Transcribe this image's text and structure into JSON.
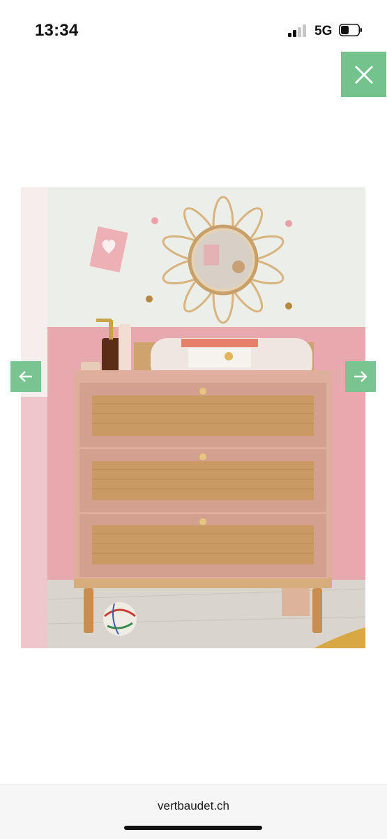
{
  "status_bar": {
    "time": "13:34",
    "network": "5G"
  },
  "viewer": {
    "close_icon": "close-icon",
    "prev_icon": "arrow-left-icon",
    "next_icon": "arrow-right-icon",
    "accent_color": "#74c38c"
  },
  "browser": {
    "domain": "vertbaudet.ch"
  }
}
